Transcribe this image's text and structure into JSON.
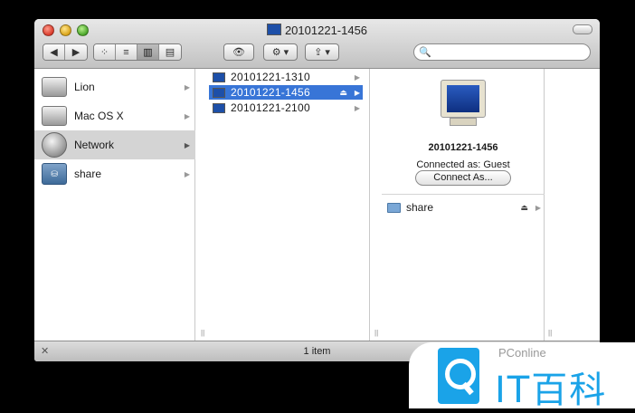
{
  "window": {
    "title": "20101221-1456",
    "toolbar": {
      "back_icon": "◀",
      "forward_icon": "▶",
      "view_icons": [
        "⁘",
        "≡",
        "▥",
        "▤"
      ],
      "eye_icon": "👁",
      "gear_icon": "⚙ ▾",
      "share_icon": "⇪ ▾",
      "search_icon": "🔍",
      "search_value": ""
    }
  },
  "sidebar": {
    "items": [
      {
        "label": "Lion",
        "arrow": "▶"
      },
      {
        "label": "Mac OS X",
        "arrow": "▶"
      },
      {
        "label": "Network",
        "arrow": "▶"
      },
      {
        "label": "share",
        "arrow": "▶"
      }
    ]
  },
  "column1": {
    "rows": [
      {
        "name": "20101221-1310",
        "arrow": "▶",
        "eject": ""
      },
      {
        "name": "20101221-1456",
        "arrow": "▶",
        "eject": "⏏"
      },
      {
        "name": "20101221-2100",
        "arrow": "▶",
        "eject": ""
      }
    ]
  },
  "preview": {
    "name": "20101221-1456",
    "connected": "Connected as: Guest",
    "button": "Connect As...",
    "shares": [
      {
        "name": "share",
        "eject": "⏏",
        "arrow": "▶"
      }
    ]
  },
  "status": {
    "text": "1 item"
  },
  "watermark": {
    "small": "PConline",
    "big": "IT百科"
  },
  "colors": {
    "selection": "#3875d7",
    "sidebar_selection": "#d4d4d4",
    "watermark_blue": "#1aa3e8"
  }
}
